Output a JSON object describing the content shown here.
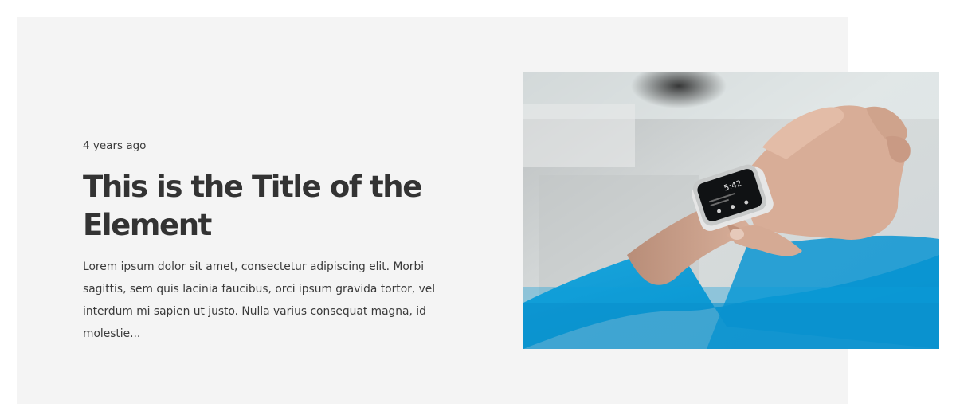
{
  "post": {
    "date": "4 years ago",
    "title": "This is the Title of the Element",
    "excerpt": "Lorem ipsum dolor sit amet, consectetur adipiscing elit. Morbi sagittis, sem quis lacinia faucibus, orci ipsum gravida tortor, vel interdum mi sapien ut justo. Nulla varius consequat magna, id molestie...",
    "image": {
      "description": "smartwatch-photo",
      "watch_time": "5:42"
    }
  },
  "colors": {
    "card_background": "#f4f4f4",
    "title": "#333333",
    "text": "#3a3a3a",
    "sleeve_blue": "#0a9fd8"
  }
}
